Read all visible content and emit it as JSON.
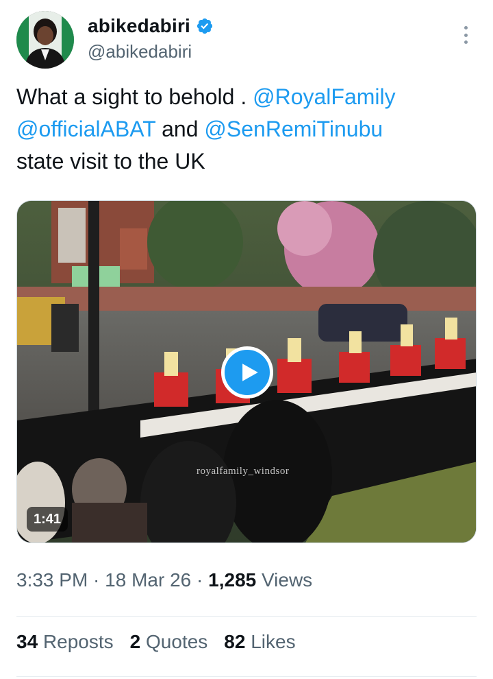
{
  "author": {
    "display_name": "abikedabiri",
    "handle": "@abikedabiri",
    "verified": true
  },
  "tweet": {
    "text_part1": "What a sight to behold . ",
    "mention1": "@RoyalFamily",
    "mention2": "@officialABAT",
    "text_and": " and ",
    "mention3": "@SenRemiTinubu",
    "text_part2": "state visit to the UK"
  },
  "media": {
    "type": "video",
    "duration": "1:41",
    "watermark": "royalfamily_windsor",
    "icon": "play-icon"
  },
  "meta": {
    "time": "3:33 PM",
    "sep1": " · ",
    "date": "18 Mar 26",
    "sep2": " · ",
    "views_count": "1,285",
    "views_label": " Views"
  },
  "stats": {
    "reposts_count": "34",
    "reposts_label": "Reposts",
    "quotes_count": "2",
    "quotes_label": "Quotes",
    "likes_count": "82",
    "likes_label": "Likes"
  },
  "colors": {
    "accent": "#1d9bf0",
    "text": "#0f1419",
    "muted": "#536471"
  }
}
